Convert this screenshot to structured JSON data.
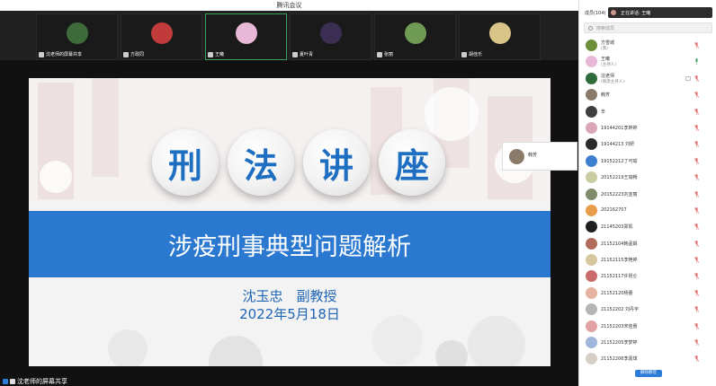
{
  "window": {
    "title": "腾讯会议"
  },
  "video_strip": {
    "tiles": [
      {
        "name": "沈老师的屏幕共享",
        "avatar_color": "#3d6b3a"
      },
      {
        "name": "方政同",
        "avatar_color": "#c23b3b"
      },
      {
        "name": "王曦",
        "avatar_color": "#e8b9d6"
      },
      {
        "name": "夏叶青",
        "avatar_color": "#3a2f52"
      },
      {
        "name": "张丽",
        "avatar_color": "#6f9b55"
      },
      {
        "name": "胡佳乐",
        "avatar_color": "#d9c48a"
      }
    ]
  },
  "slide": {
    "title_chars": [
      "刑",
      "法",
      "讲",
      "座"
    ],
    "subtitle": "涉疫刑事典型问题解析",
    "lecturer": "沈玉忠　副教授",
    "date": "2022年5月18日",
    "accent": "#2a78cf"
  },
  "speaker_popup": {
    "name": "韩芳"
  },
  "bottom_bar": {
    "label": "沈老师的屏幕共享"
  },
  "panel": {
    "title": "成员(104)",
    "speaking": "正在讲话: 王曦",
    "search_placeholder": "搜索成员",
    "members": [
      {
        "name": "方雪城",
        "role": "(我)",
        "color": "#6b8f3a"
      },
      {
        "name": "王曦",
        "role": "(主持人)",
        "color": "#e8b9d6"
      },
      {
        "name": "沈老师",
        "role": "(联席主持人)",
        "color": "#2f6a3a"
      },
      {
        "name": "韩芳",
        "role": "",
        "color": "#8a7a6a"
      },
      {
        "name": "辛",
        "role": "",
        "color": "#3e3e3e"
      },
      {
        "name": "19144201李婷婷",
        "role": "",
        "color": "#d9a5b8"
      },
      {
        "name": "19144213 刘妍",
        "role": "",
        "color": "#2b2b2b"
      },
      {
        "name": "19152212丁可瑜",
        "role": "",
        "color": "#3f7fd0"
      },
      {
        "name": "20152219王瑜畅",
        "role": "",
        "color": "#c9cba3"
      },
      {
        "name": "20152223刘亚丽",
        "role": "",
        "color": "#7f8b6b"
      },
      {
        "name": "202162707",
        "role": "",
        "color": "#e89d4a"
      },
      {
        "name": "21145203郑凯",
        "role": "",
        "color": "#1e1e1e"
      },
      {
        "name": "21152104韩孟娟",
        "role": "",
        "color": "#b06b5a"
      },
      {
        "name": "21152115李艳婷",
        "role": "",
        "color": "#d7c7a0"
      },
      {
        "name": "21152117许昆仑",
        "role": "",
        "color": "#c96b6b"
      },
      {
        "name": "21152120杨蕾",
        "role": "",
        "color": "#e6b3a0"
      },
      {
        "name": "21152202 刘丹宇",
        "role": "",
        "color": "#b5b5b5"
      },
      {
        "name": "21152203宋佳惠",
        "role": "",
        "color": "#e0a2a2"
      },
      {
        "name": "21152205李梦婷",
        "role": "",
        "color": "#9fb5d9"
      },
      {
        "name": "21152206李嘉琪",
        "role": "",
        "color": "#d6cfc5"
      }
    ],
    "mute_all": "解除静音"
  }
}
